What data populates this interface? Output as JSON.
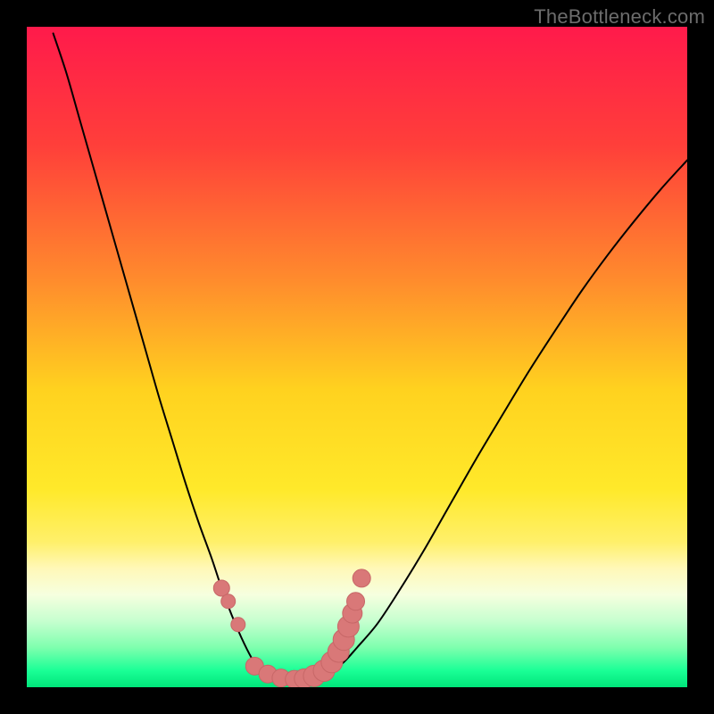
{
  "watermark": "TheBottleneck.com",
  "chart_data": {
    "type": "line",
    "title": "",
    "xlabel": "",
    "ylabel": "",
    "xlim": [
      0,
      100
    ],
    "ylim": [
      0,
      100
    ],
    "gradient_stops": [
      {
        "offset": 0.0,
        "color": "#ff1a4b"
      },
      {
        "offset": 0.18,
        "color": "#ff3f3a"
      },
      {
        "offset": 0.38,
        "color": "#ff8a2d"
      },
      {
        "offset": 0.55,
        "color": "#ffd21f"
      },
      {
        "offset": 0.7,
        "color": "#ffe92a"
      },
      {
        "offset": 0.78,
        "color": "#fff06a"
      },
      {
        "offset": 0.82,
        "color": "#fff8b8"
      },
      {
        "offset": 0.86,
        "color": "#f6ffdf"
      },
      {
        "offset": 0.9,
        "color": "#c6ffcf"
      },
      {
        "offset": 0.94,
        "color": "#7effae"
      },
      {
        "offset": 0.975,
        "color": "#1aff96"
      },
      {
        "offset": 1.0,
        "color": "#00e57a"
      }
    ],
    "series": [
      {
        "name": "left-branch",
        "x": [
          4,
          6,
          8,
          10,
          12,
          14,
          16,
          18,
          20,
          22,
          24,
          26,
          28,
          29.5,
          31,
          32.5,
          34,
          35.5
        ],
        "y": [
          99,
          93,
          86,
          79,
          72,
          65,
          58,
          51,
          44,
          37.5,
          31,
          25,
          19.5,
          15,
          11,
          7.5,
          4.5,
          2.2
        ]
      },
      {
        "name": "valley",
        "x": [
          35.5,
          36.5,
          38,
          40,
          42,
          44,
          46
        ],
        "y": [
          2.2,
          1.4,
          0.9,
          0.7,
          0.8,
          1.3,
          2.3
        ]
      },
      {
        "name": "right-branch",
        "x": [
          46,
          48,
          50,
          53,
          56,
          60,
          64,
          68,
          72,
          76,
          80,
          84,
          88,
          92,
          96,
          100
        ],
        "y": [
          2.3,
          3.8,
          6,
          9.5,
          14,
          20.5,
          27.5,
          34.5,
          41.2,
          47.8,
          54,
          60,
          65.5,
          70.6,
          75.4,
          79.8
        ]
      }
    ],
    "highlight_band": {
      "y_top": 23,
      "y_bottom": 2
    },
    "highlight_markers": {
      "color": "#d97878",
      "stroke": "#c76767",
      "radius_small": 8,
      "radius_large": 12,
      "points": [
        {
          "x": 29.5,
          "y": 15,
          "r": 9
        },
        {
          "x": 30.5,
          "y": 13,
          "r": 8
        },
        {
          "x": 32.0,
          "y": 9.5,
          "r": 8
        },
        {
          "x": 34.5,
          "y": 3.2,
          "r": 10
        },
        {
          "x": 36.5,
          "y": 2.0,
          "r": 10
        },
        {
          "x": 38.5,
          "y": 1.4,
          "r": 10
        },
        {
          "x": 40.5,
          "y": 1.2,
          "r": 10
        },
        {
          "x": 42.0,
          "y": 1.3,
          "r": 11
        },
        {
          "x": 43.5,
          "y": 1.7,
          "r": 12
        },
        {
          "x": 45.0,
          "y": 2.5,
          "r": 12
        },
        {
          "x": 46.2,
          "y": 3.8,
          "r": 12
        },
        {
          "x": 47.2,
          "y": 5.4,
          "r": 12
        },
        {
          "x": 48.0,
          "y": 7.2,
          "r": 12
        },
        {
          "x": 48.7,
          "y": 9.2,
          "r": 12
        },
        {
          "x": 49.3,
          "y": 11.2,
          "r": 11
        },
        {
          "x": 49.8,
          "y": 13.0,
          "r": 10
        },
        {
          "x": 50.7,
          "y": 16.5,
          "r": 10
        }
      ]
    }
  }
}
